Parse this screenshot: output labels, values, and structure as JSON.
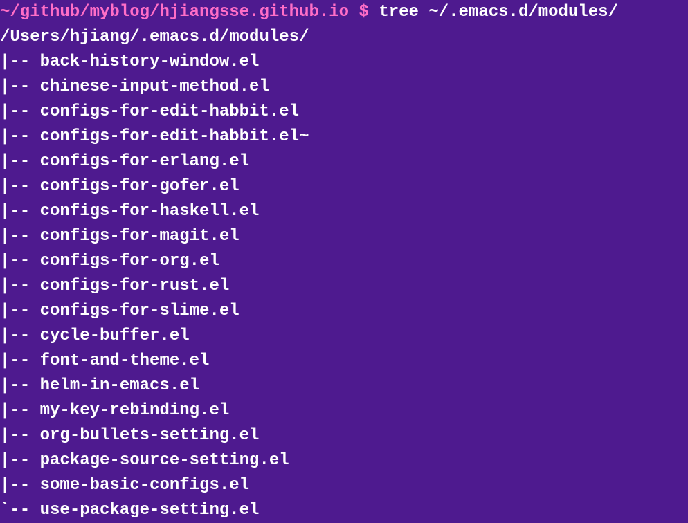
{
  "prompt": {
    "path": "~/github/myblog/hjiangsse.github.io",
    "separator": " $ ",
    "command": "tree ~/.emacs.d/modules/"
  },
  "root_path": "/Users/hjiang/.emacs.d/modules/",
  "files": [
    "back-history-window.el",
    "chinese-input-method.el",
    "configs-for-edit-habbit.el",
    "configs-for-edit-habbit.el~",
    "configs-for-erlang.el",
    "configs-for-gofer.el",
    "configs-for-haskell.el",
    "configs-for-magit.el",
    "configs-for-org.el",
    "configs-for-rust.el",
    "configs-for-slime.el",
    "cycle-buffer.el",
    "font-and-theme.el",
    "helm-in-emacs.el",
    "my-key-rebinding.el",
    "org-bullets-setting.el",
    "package-source-setting.el",
    "some-basic-configs.el",
    "use-package-setting.el"
  ],
  "branch_mid": "|-- ",
  "branch_last": "`-- "
}
